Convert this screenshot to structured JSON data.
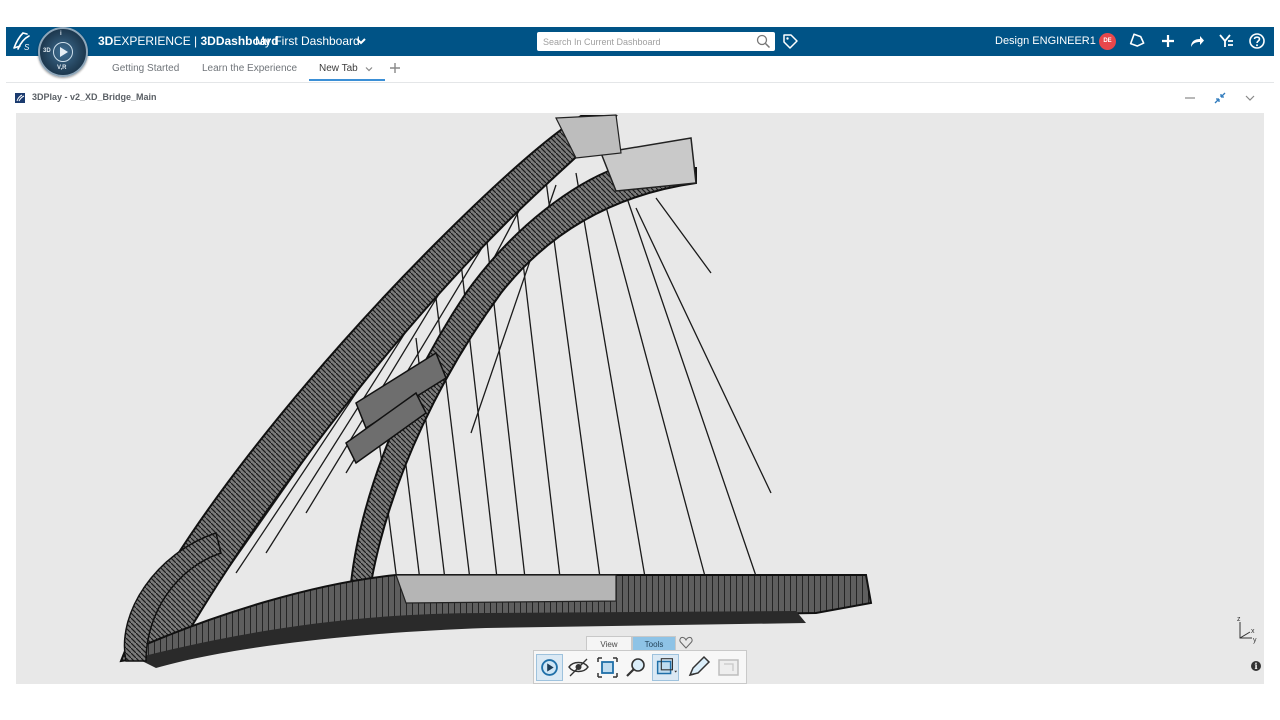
{
  "app": {
    "title_brand": "3D",
    "title_experience": "EXPERIENCE",
    "title_sep": " | ",
    "title_dashboard_bold": "3DDashboard",
    "dashboard_name": "My First Dashboard",
    "compass_labels": [
      "3D",
      "i",
      "V,R"
    ]
  },
  "search": {
    "placeholder": "Search In Current Dashboard"
  },
  "user": {
    "name": "Design ENGINEER1",
    "initials": "DE",
    "avatar_color": "#e8474b"
  },
  "topbar_icons": [
    "tag-icon",
    "notifications-icon",
    "add-icon",
    "share-icon",
    "apps-icon",
    "help-icon"
  ],
  "tabs": [
    {
      "label": "Getting Started",
      "active": false
    },
    {
      "label": "Learn the Experience",
      "active": false
    },
    {
      "label": "New Tab",
      "active": true
    }
  ],
  "widget": {
    "title": "3DPlay - v2_XD_Bridge_Main",
    "controls": [
      "minimize-icon",
      "restore-icon",
      "widget-menu-icon"
    ]
  },
  "viewer": {
    "axis_labels": {
      "z": "z",
      "x": "x",
      "y": "y"
    },
    "info": "i"
  },
  "action_bar": {
    "tabs": [
      {
        "label": "View",
        "active": false
      },
      {
        "label": "Tools",
        "active": true
      }
    ],
    "tools": [
      "play-icon",
      "hide-show-icon",
      "fit-all-icon",
      "zoom-icon",
      "section-icon",
      "annotate-icon",
      "capture-icon"
    ]
  },
  "colors": {
    "topbar": "#005386",
    "viewer_bg": "#e8e8e8",
    "tab_active_underline": "#3b8fd6"
  }
}
